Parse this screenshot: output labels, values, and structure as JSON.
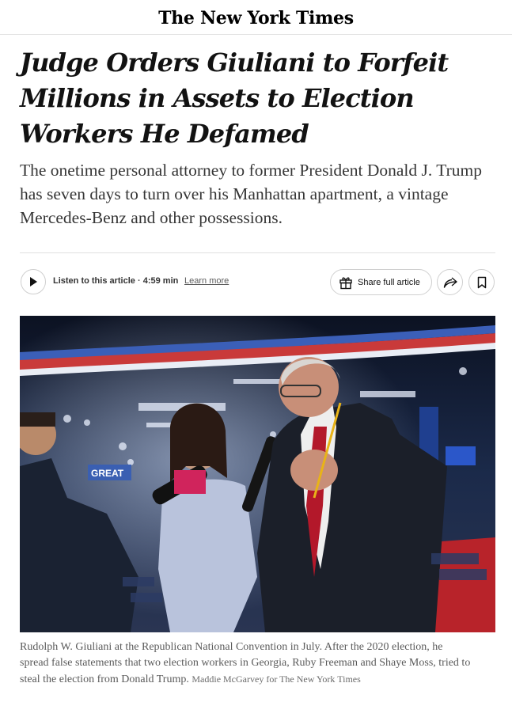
{
  "masthead": {
    "logo_text": "The New York Times"
  },
  "article": {
    "headline": "Judge Orders Giuliani to Forfeit Millions in Assets to Election Workers He Defamed",
    "summary": "The onetime personal attorney to former President Donald J. Trump has seven days to turn over his Manhattan apartment, a vintage Mercedes-Benz and other possessions."
  },
  "toolbar": {
    "listen_label": "Listen to this article",
    "listen_separator": "·",
    "listen_duration": "4:59 min",
    "learn_more": "Learn more",
    "share_label": "Share full article",
    "icons": {
      "play": "play-icon",
      "gift": "gift-icon",
      "share": "share-arrow-icon",
      "bookmark": "bookmark-icon"
    }
  },
  "photo": {
    "sign_text": "GREAT"
  },
  "caption": {
    "text": "Rudolph W. Giuliani at the Republican National Convention in July. After the 2020 election, he spread false statements that two election workers in Georgia, Ruby Freeman and Shaye Moss, tried to steal the election from Donald Trump.",
    "credit": "Maddie McGarvey for The New York Times"
  },
  "colors": {
    "text": "#121212",
    "summary_text": "#363636",
    "caption_text": "#5a5a5a",
    "border": "#dfdfdf"
  }
}
